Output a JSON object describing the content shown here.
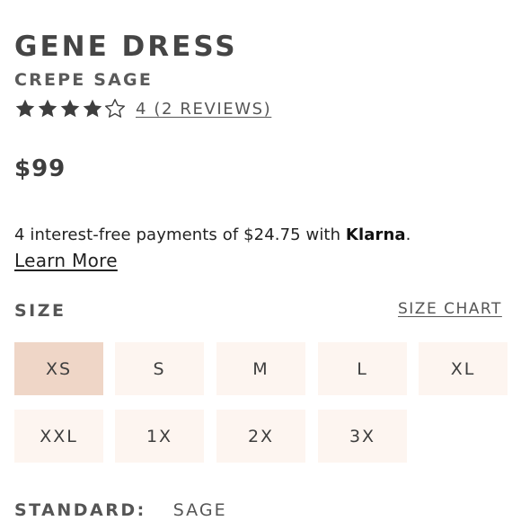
{
  "product": {
    "name": "GENE DRESS",
    "color_name": "CREPE SAGE",
    "rating": 4,
    "rating_max": 5,
    "reviews_text": "4 (2 REVIEWS)",
    "price": "$99"
  },
  "klarna": {
    "text": "4 interest-free payments of $24.75 with ",
    "brand": "Klarna",
    "suffix": ".",
    "learn_more": "Learn More"
  },
  "size": {
    "label": "SIZE",
    "chart_link": "SIZE CHART",
    "options": [
      "XS",
      "S",
      "M",
      "L",
      "XL",
      "XXL",
      "1X",
      "2X",
      "3X"
    ],
    "selected": "XS"
  },
  "standard": {
    "label": "STANDARD:",
    "value": "SAGE"
  },
  "colors": {
    "star_fill": "#3e3e3e",
    "size_bg": "#fdf5f0",
    "size_selected_bg": "#efd6c7"
  },
  "icons": {
    "star_filled": "star-filled-icon",
    "star_empty": "star-outline-icon"
  }
}
